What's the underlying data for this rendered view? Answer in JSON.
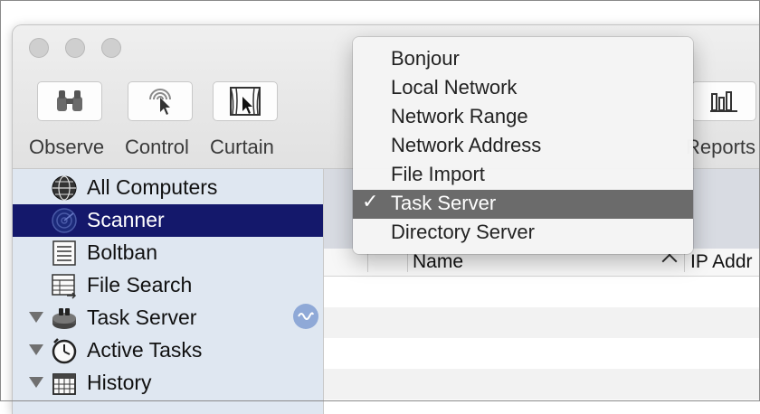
{
  "toolbar": {
    "items": [
      {
        "label": "Observe",
        "icon": "binoculars-icon"
      },
      {
        "label": "Control",
        "icon": "remote-control-icon"
      },
      {
        "label": "Curtain",
        "icon": "curtain-icon"
      },
      {
        "label": "Reports",
        "icon": "reports-icon"
      }
    ]
  },
  "sidebar": {
    "items": [
      {
        "label": "All Computers",
        "icon": "globe-icon",
        "selected": false
      },
      {
        "label": "Scanner",
        "icon": "radar-icon",
        "selected": true
      },
      {
        "label": "Boltban",
        "icon": "list-icon",
        "selected": false
      },
      {
        "label": "File Search",
        "icon": "file-search-icon",
        "selected": false
      },
      {
        "label": "Task Server",
        "icon": "task-server-icon",
        "selected": false,
        "expandable": true
      },
      {
        "label": "Active Tasks",
        "icon": "clock-icon",
        "selected": false,
        "expandable": true
      },
      {
        "label": "History",
        "icon": "calendar-icon",
        "selected": false,
        "expandable": true
      }
    ]
  },
  "table": {
    "columns": [
      "Name",
      "IP Addr"
    ]
  },
  "scanner_menu": {
    "items": [
      "Bonjour",
      "Local Network",
      "Network Range",
      "Network Address",
      "File Import",
      "Task Server",
      "Directory Server"
    ],
    "selected": "Task Server",
    "check_mark": "✓"
  },
  "colors": {
    "sidebar_bg": "#dfe7f1",
    "sidebar_selected": "#14186b",
    "menu_selected": "#6b6b6b",
    "activity_badge": "#8fa9d7"
  }
}
